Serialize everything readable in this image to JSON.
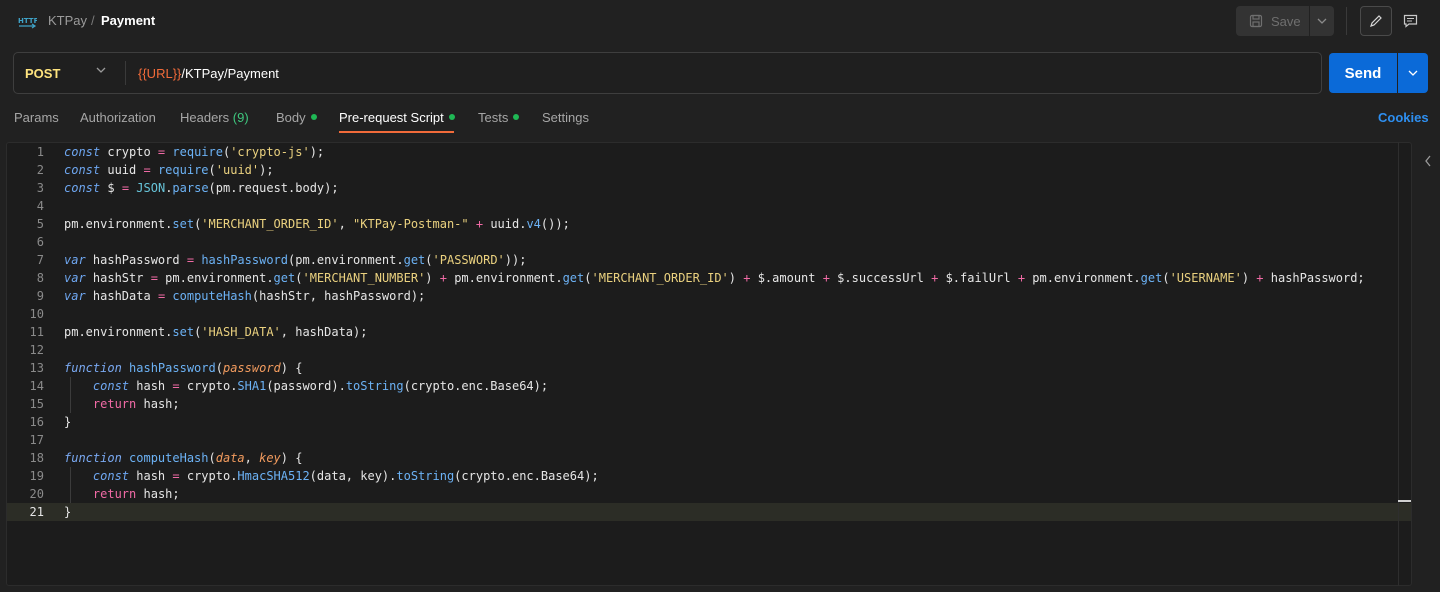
{
  "header": {
    "breadcrumb_parent": "KTPay",
    "breadcrumb_separator": "/",
    "breadcrumb_current": "Payment",
    "save_label": "Save",
    "icon_http": "http-icon"
  },
  "request": {
    "method": "POST",
    "url_variable": "{{URL}}",
    "url_path": "/KTPay/Payment",
    "send_label": "Send"
  },
  "tabs": {
    "params": "Params",
    "authorization": "Authorization",
    "headers": "Headers",
    "headers_count": "(9)",
    "body": "Body",
    "prerequest": "Pre-request Script",
    "tests": "Tests",
    "settings": "Settings",
    "cookies": "Cookies",
    "active": "Pre-request Script"
  },
  "editor": {
    "active_line": 21,
    "line_numbers": [
      "1",
      "2",
      "3",
      "4",
      "5",
      "6",
      "7",
      "8",
      "9",
      "10",
      "11",
      "12",
      "13",
      "14",
      "15",
      "16",
      "17",
      "18",
      "19",
      "20",
      "21"
    ]
  },
  "colors": {
    "accent_send": "#0b6ad8",
    "tab_underline": "#f26b3a",
    "method": "#ffe47e",
    "status_dot": "#1fb855",
    "link": "#2e8ff0"
  }
}
